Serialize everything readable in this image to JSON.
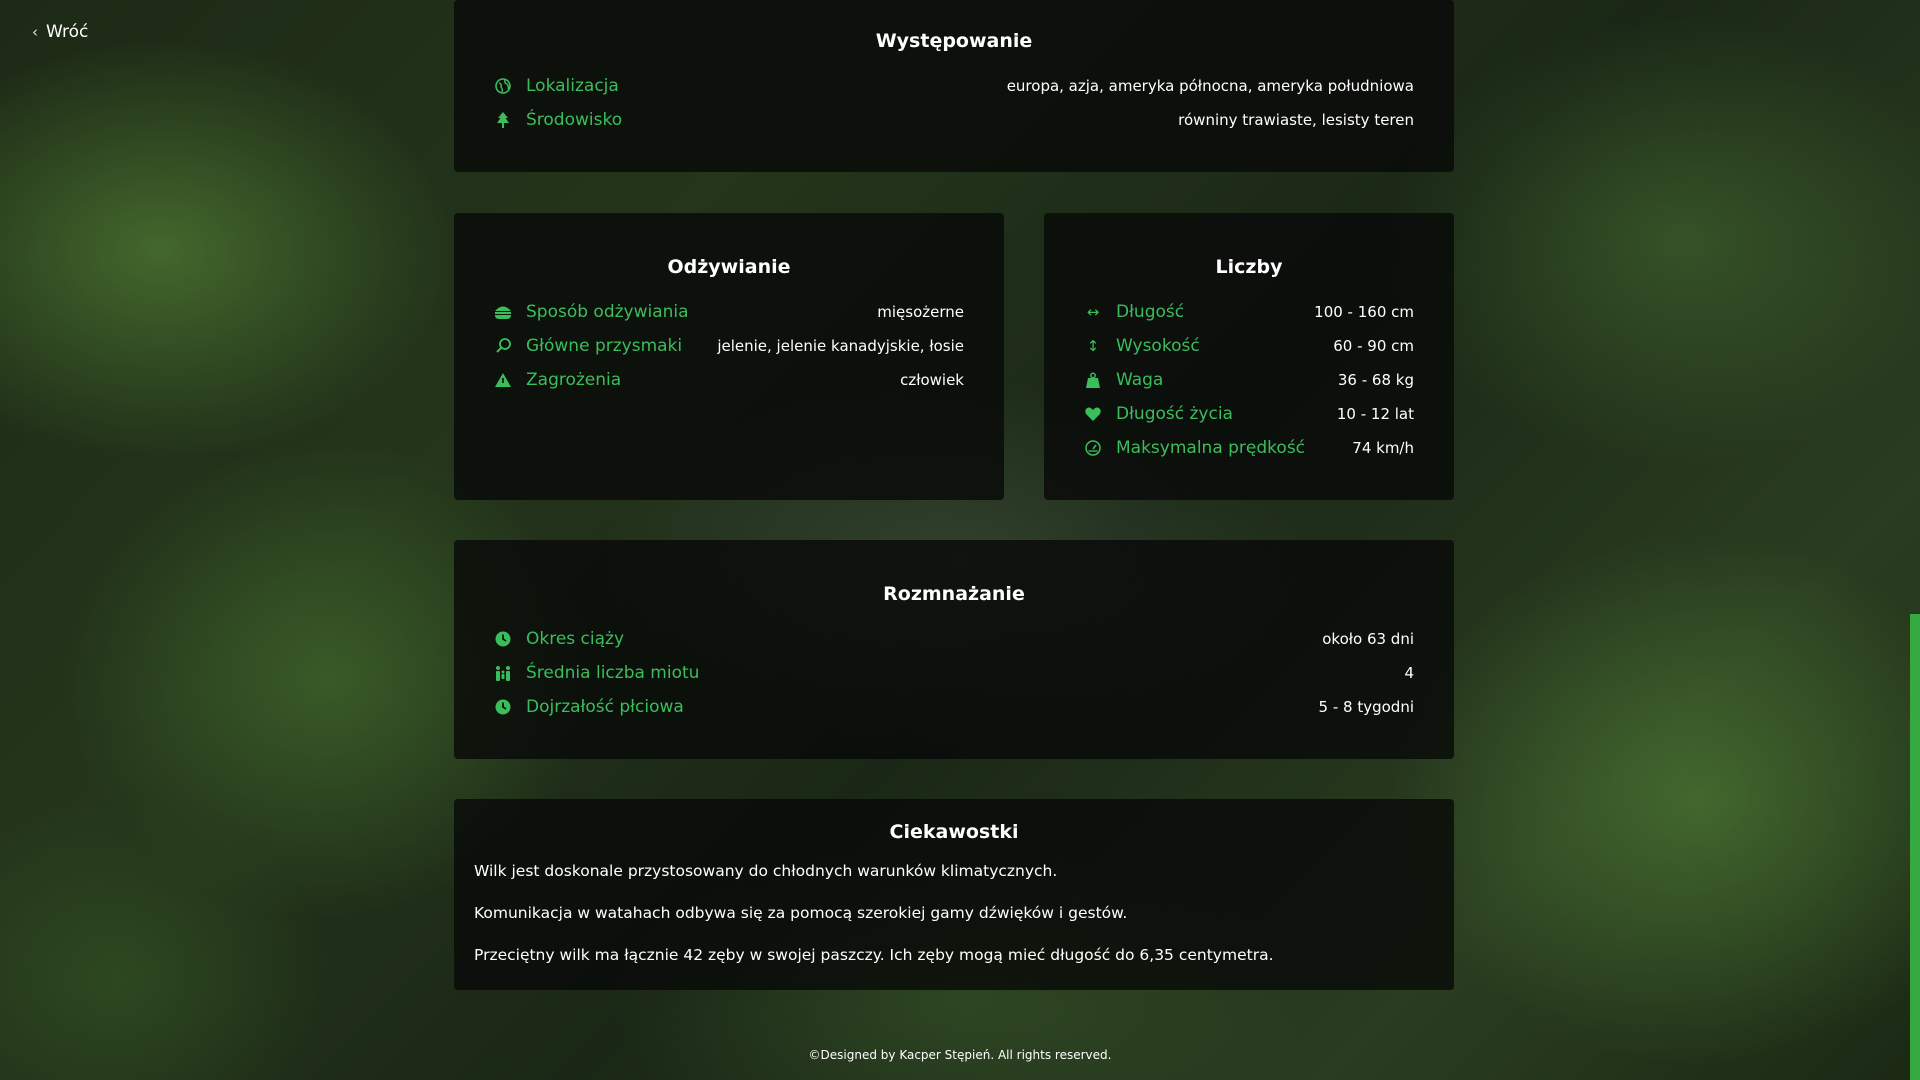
{
  "nav": {
    "back_label": "Wróć"
  },
  "occurrence": {
    "title": "Występowanie",
    "rows": [
      {
        "icon": "globe-icon",
        "label": "Lokalizacja",
        "value": "europa, azja, ameryka północna, ameryka południowa"
      },
      {
        "icon": "tree-icon",
        "label": "Środowisko",
        "value": "równiny trawiaste, lesisty teren"
      }
    ]
  },
  "diet": {
    "title": "Odżywianie",
    "rows": [
      {
        "icon": "burger-icon",
        "label": "Sposób odżywiania",
        "value": "mięsożerne"
      },
      {
        "icon": "drumstick-icon",
        "label": "Główne przysmaki",
        "value": "jelenie, jelenie kanadyjskie, łosie"
      },
      {
        "icon": "warning-icon",
        "label": "Zagrożenia",
        "value": "człowiek"
      }
    ]
  },
  "numbers": {
    "title": "Liczby",
    "rows": [
      {
        "icon": "horizontal-arrows-icon",
        "label": "Długość",
        "value": "100 - 160 cm"
      },
      {
        "icon": "vertical-arrows-icon",
        "label": "Wysokość",
        "value": "60 - 90 cm"
      },
      {
        "icon": "weight-icon",
        "label": "Waga",
        "value": "36 - 68 kg"
      },
      {
        "icon": "heart-icon",
        "label": "Długość życia",
        "value": "10 - 12 lat"
      },
      {
        "icon": "speedometer-icon",
        "label": "Maksymalna prędkość",
        "value": "74 km/h"
      }
    ]
  },
  "reproduction": {
    "title": "Rozmnażanie",
    "rows": [
      {
        "icon": "clock-icon",
        "label": "Okres ciąży",
        "value": "około 63 dni"
      },
      {
        "icon": "family-icon",
        "label": "Średnia liczba miotu",
        "value": "4"
      },
      {
        "icon": "clock-icon",
        "label": "Dojrzałość płciowa",
        "value": "5 - 8 tygodni"
      }
    ]
  },
  "trivia": {
    "title": "Ciekawostki",
    "items": [
      "Wilk jest doskonale przystosowany do chłodnych warunków klimatycznych.",
      "Komunikacja w watahach odbywa się za pomocą szerokiej gamy dźwięków i gestów.",
      "Przeciętny wilk ma łącznie 42 zęby w swojej paszczy. Ich zęby mogą mieć długość do 6,35 centymetra."
    ]
  },
  "footer": {
    "text": "©Designed by Kacper Stępień. All rights reserved."
  },
  "theme": {
    "accent": "#3bbd5c",
    "scrollbar": "#35a83f"
  }
}
